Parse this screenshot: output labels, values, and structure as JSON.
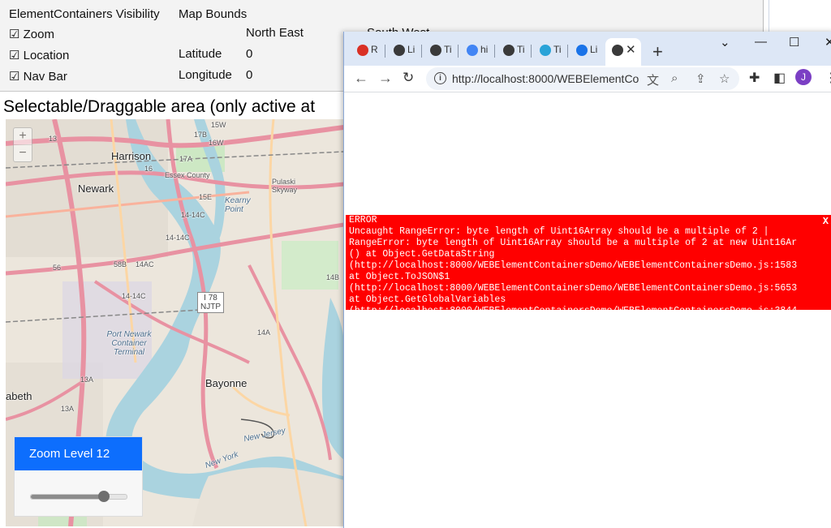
{
  "panel": {
    "visibility_title": "ElementContainers Visibility",
    "zoom_label": "Zoom",
    "location_label": "Location",
    "navbar_label": "Nav Bar",
    "check_mark": "☑",
    "bounds_title": "Map Bounds",
    "north_east": "North East",
    "south_west": "South West",
    "latitude_label": "Latitude",
    "longitude_label": "Longitude",
    "latitude_value": "0",
    "longitude_value": "0"
  },
  "area_title": "Selectable/Draggable area (only active at",
  "map": {
    "zoom_in": "+",
    "zoom_out": "−",
    "labels": {
      "harrison": "Harrison",
      "newark": "Newark",
      "kearny_point": "Kearny Point",
      "pulaski": "Pulaski Skyway",
      "essex": "Essex County",
      "port_newark": "Port Newark Container Terminal",
      "bayonne": "Bayonne",
      "elizabeth": "abeth",
      "new_jersey": "New Jersey",
      "new_york": "New York"
    },
    "shields": {
      "i78": "I 78",
      "njtp": "NJTP",
      "r15w": "15W",
      "r17b": "17B",
      "r16w": "16W",
      "r17a": "17A",
      "r16": "16",
      "r15e": "15E",
      "r14_14c": "14-14C",
      "r14c": "14C",
      "r14_14c2": "14-14C",
      "r58b": "58B",
      "r14ac": "14AC",
      "r14": "14",
      "r56": "56",
      "r14_14c3": "14-14C",
      "r14a": "14A",
      "r13a": "13A",
      "r13a2": "13A",
      "r14b": "14B",
      "r13": "13"
    }
  },
  "zoom_card": {
    "title": "Zoom Level 12",
    "slider_fraction": 0.76
  },
  "browser": {
    "tabs": [
      {
        "title": "R",
        "icon": "gmail-icon",
        "color": "#d93025"
      },
      {
        "title": "Li",
        "icon": "globe-icon",
        "color": "#3a3a3a"
      },
      {
        "title": "Ti",
        "icon": "globe-icon",
        "color": "#3a3a3a"
      },
      {
        "title": "hi",
        "icon": "google-icon",
        "color": "#4285f4"
      },
      {
        "title": "Ti",
        "icon": "globe-icon",
        "color": "#3a3a3a"
      },
      {
        "title": "Ti",
        "icon": "loading-icon",
        "color": "#29a3d8"
      },
      {
        "title": "Li",
        "icon": "headset-icon",
        "color": "#1a73e8"
      }
    ],
    "active_tab_close": "✕",
    "new_tab": "+",
    "url": "http://localhost:8000/WEBElementCo...",
    "profile_initial": "J",
    "profile_color": "#7b3fc4"
  },
  "error": {
    "title": "ERROR",
    "close": "X",
    "lines": [
      "Uncaught RangeError: byte length of Uint16Array should be a multiple of 2 |",
      "RangeError: byte length of Uint16Array should be a multiple of 2 at new Uint16Ar",
      "() at Object.GetDataString",
      "(http://localhost:8000/WEBElementContainersDemo/WEBElementContainersDemo.js:1583",
      "at Object.ToJSON$1",
      "(http://localhost:8000/WEBElementContainersDemo/WEBElementContainersDemo.js:5653",
      "at Object.GetGlobalVariables",
      "(http://localhost:8000/WEBElementContainersDemo/WEBElementContainersDemo.js:3844"
    ]
  },
  "colors": {
    "error_bg": "#ff0000",
    "zoom_header": "#0d6efd",
    "tabbar": "#dde7f6",
    "water": "#aad3df",
    "motorway": "#e892a2"
  }
}
